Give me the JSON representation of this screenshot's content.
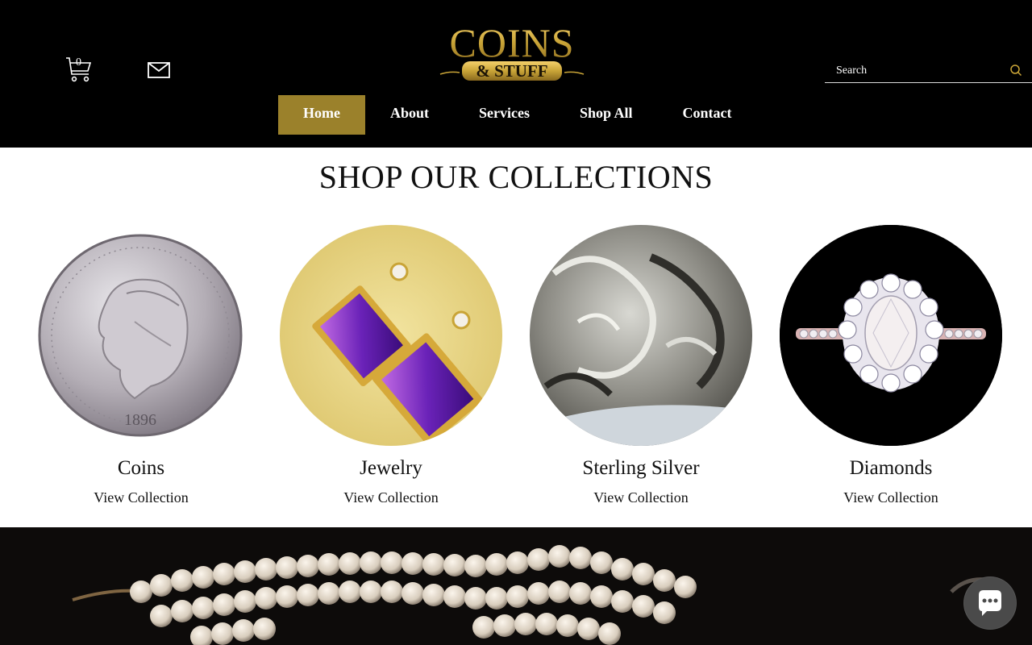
{
  "header": {
    "cart_count": "0",
    "search_placeholder": "Search",
    "logo_text_main": "COINS",
    "logo_text_sub": "& STUFF"
  },
  "nav": {
    "items": [
      {
        "label": "Home",
        "active": true
      },
      {
        "label": "About"
      },
      {
        "label": "Services"
      },
      {
        "label": "Shop All"
      },
      {
        "label": "Contact"
      }
    ]
  },
  "collections": {
    "title": "SHOP OUR COLLECTIONS",
    "cards": [
      {
        "name": "Coins",
        "link": "View Collection"
      },
      {
        "name": "Jewelry",
        "link": "View Collection"
      },
      {
        "name": "Sterling Silver",
        "link": "View Collection"
      },
      {
        "name": "Diamonds",
        "link": "View Collection"
      }
    ]
  },
  "colors": {
    "header_bg": "#000000",
    "nav_active": "#9b812b",
    "logo_gold": "#c9a437"
  },
  "icons": [
    "cart-icon",
    "mail-icon",
    "search-icon",
    "chat-icon"
  ]
}
